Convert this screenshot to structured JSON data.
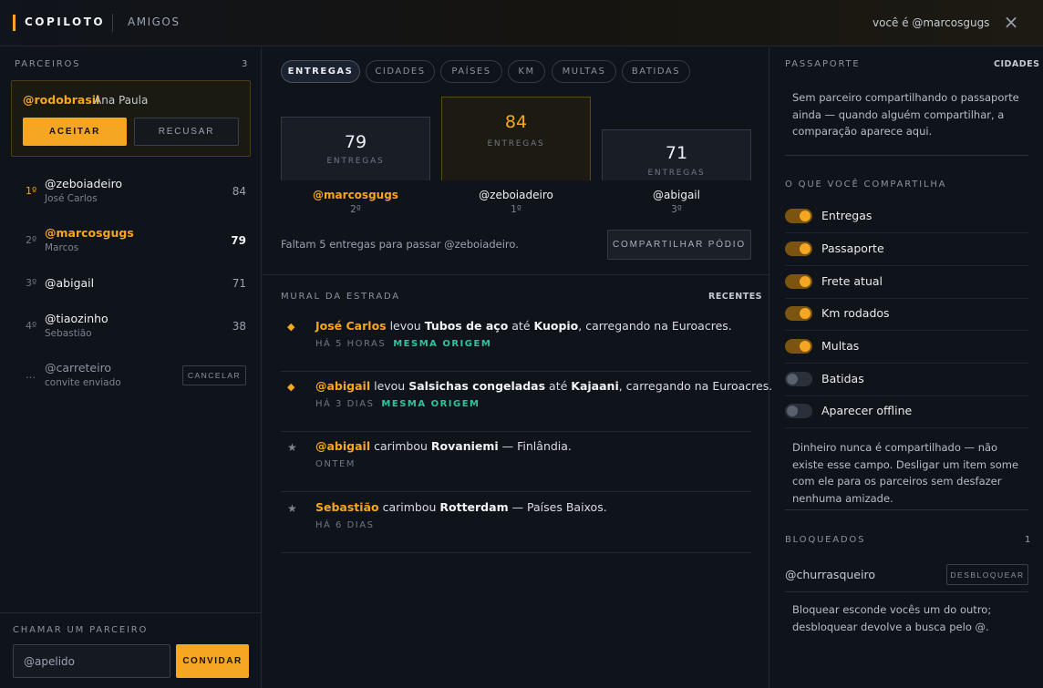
{
  "header": {
    "brand": "COPILOTO",
    "subtitle": "AMIGOS",
    "whoami": "você é @marcosgugs",
    "close_icon": "close-icon"
  },
  "partners": {
    "label": "PARCEIROS",
    "count": "3",
    "invite": {
      "handle": "@rodobrasil",
      "name": "Ana Paula",
      "accept_label": "ACEITAR",
      "refuse_label": "RECUSAR"
    },
    "ranking": [
      {
        "pos": "1º",
        "handle": "@zeboiadeiro",
        "name": "José Carlos",
        "score": "84"
      },
      {
        "pos": "2º",
        "handle": "@marcosgugs",
        "name": "Marcos",
        "score": "79"
      },
      {
        "pos": "3º",
        "handle": "@abigail",
        "name": "",
        "score": "71"
      },
      {
        "pos": "4º",
        "handle": "@tiaozinho",
        "name": "Sebastião",
        "score": "38"
      }
    ],
    "pending": {
      "pos": "…",
      "handle": "@carreteiro",
      "status": "convite enviado",
      "cancel_label": "CANCELAR"
    }
  },
  "invite_partner": {
    "label": "CHAMAR UM PARCEIRO",
    "placeholder": "@apelido",
    "button_label": "CONVIDAR"
  },
  "tabs": [
    "ENTREGAS",
    "CIDADES",
    "PAÍSES",
    "KM",
    "MULTAS",
    "BATIDAS"
  ],
  "active_tab": "ENTREGAS",
  "podium": {
    "left": {
      "score": "79",
      "label": "ENTREGAS",
      "handle": "@marcosgugs",
      "place": "2º"
    },
    "center": {
      "score": "84",
      "label": "ENTREGAS",
      "handle": "@zeboiadeiro",
      "place": "1º"
    },
    "right": {
      "score": "71",
      "label": "ENTREGAS",
      "handle": "@abigail",
      "place": "3º"
    },
    "gap_text": "Faltam 5 entregas para passar @zeboiadeiro.",
    "share_label": "COMPARTILHAR PÓDIO"
  },
  "feed": {
    "label": "MURAL DA ESTRADA",
    "sort_label": "RECENTES",
    "items": [
      {
        "icon": "diamond-icon",
        "actor": "José Carlos",
        "verb": " levou ",
        "cargo": "Tubos de aço",
        "prep": " até ",
        "place": "Kuopio",
        "suffix": ", carregando na Euroacres.",
        "time": "HÁ 5 HORAS",
        "tag": "MESMA ORIGEM"
      },
      {
        "icon": "diamond-icon",
        "actor": "@abigail",
        "verb": " levou ",
        "cargo": "Salsichas congeladas",
        "prep": " até ",
        "place": "Kajaani",
        "suffix": ", carregando na Euroacres.",
        "time": "HÁ 3 DIAS",
        "tag": "MESMA ORIGEM"
      },
      {
        "icon": "star-icon",
        "actor": "@abigail",
        "verb": " carimbou ",
        "cargo": "Rovaniemi",
        "prep": "",
        "place": "",
        "suffix": " — Finlândia.",
        "time": "ONTEM",
        "tag": ""
      },
      {
        "icon": "star-icon",
        "actor": "Sebastião",
        "verb": " carimbou ",
        "cargo": "Rotterdam",
        "prep": "",
        "place": "",
        "suffix": " — Países Baixos.",
        "time": "HÁ 6 DIAS",
        "tag": ""
      }
    ]
  },
  "passport": {
    "label": "PASSAPORTE",
    "link": "CIDADES",
    "empty_text": "Sem parceiro compartilhando o passaporte ainda — quando alguém compartilhar, a comparação aparece aqui."
  },
  "sharing": {
    "label": "O QUE VOCÊ COMPARTILHA",
    "toggles": [
      {
        "label": "Entregas",
        "on": true
      },
      {
        "label": "Passaporte",
        "on": true
      },
      {
        "label": "Frete atual",
        "on": true
      },
      {
        "label": "Km rodados",
        "on": true
      },
      {
        "label": "Multas",
        "on": true
      },
      {
        "label": "Batidas",
        "on": false
      },
      {
        "label": "Aparecer offline",
        "on": false
      }
    ],
    "note": "Dinheiro nunca é compartilhado — não existe esse campo. Desligar um item some com ele para os parceiros sem desfazer nenhuma amizade."
  },
  "blocked": {
    "label": "BLOQUEADOS",
    "count": "1",
    "handle": "@churrasqueiro",
    "unblock_label": "DESBLOQUEAR",
    "note": "Bloquear esconde vocês um do outro; desbloquear devolve a busca pelo @."
  },
  "colors": {
    "accent": "#f5a623",
    "tag_green": "#2fc4a0",
    "background": "#0f131a"
  }
}
